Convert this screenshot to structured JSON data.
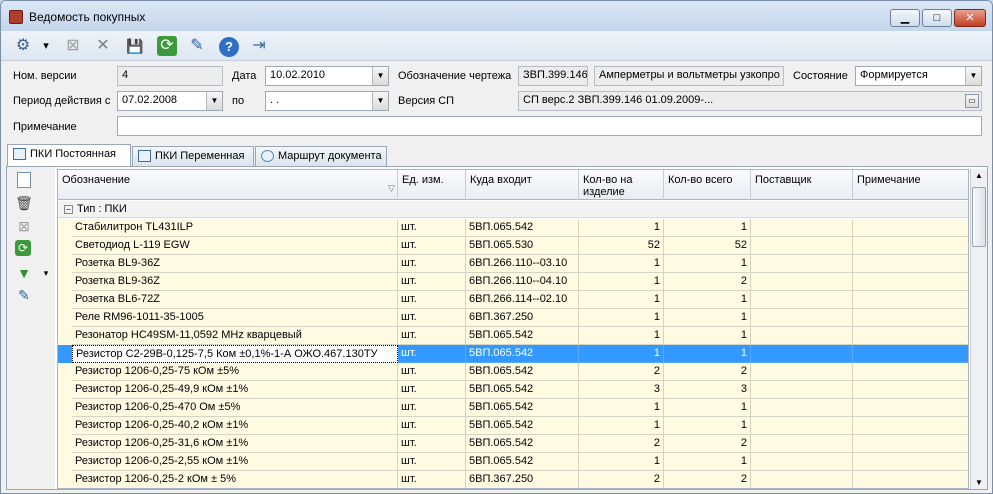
{
  "window": {
    "title": "Ведомость покупных",
    "min": "▁",
    "max": "□",
    "close": "✕"
  },
  "toolbar": {
    "buttons": [
      {
        "name": "tools-icon",
        "glyph": "⚙"
      },
      {
        "name": "dropdown-arrow-icon",
        "glyph": "▾"
      },
      {
        "name": "disabled-box-icon",
        "glyph": "⊠"
      },
      {
        "name": "close-x-icon",
        "glyph": "✕"
      },
      {
        "name": "save-icon",
        "glyph": "💾"
      },
      {
        "name": "refresh-icon",
        "glyph": "⟳"
      },
      {
        "name": "edit-icon",
        "glyph": "✎"
      },
      {
        "name": "help-icon",
        "glyph": "?"
      },
      {
        "name": "exit-icon",
        "glyph": "⇥"
      }
    ]
  },
  "form": {
    "version_label": "Ном. версии",
    "version_value": "4",
    "date_label": "Дата",
    "date_value": "10.02.2010",
    "drawing_label": "Обозначение чертежа",
    "drawing_code": "ЗВП.399.146",
    "drawing_name": "Амперметры и вольтметры узкопро",
    "state_label": "Состояние",
    "state_value": "Формируется",
    "period_label": "Период действия с",
    "period_from": "07.02.2008",
    "period_to_label": "по",
    "period_to": " . .",
    "sp_label": "Версия СП",
    "sp_value": "СП верс.2 ЗВП.399.146 01.09.2009-...",
    "note_label": "Примечание",
    "note_value": ""
  },
  "tabs": [
    "ПКИ Постоянная",
    "ПКИ Переменная",
    "Маршрут документа"
  ],
  "grid": {
    "columns": [
      "Обозначение",
      "Ед. изм.",
      "Куда входит",
      "Кол-во на изделие",
      "Кол-во всего",
      "Поставщик",
      "Примечание"
    ],
    "group": "Тип : ПКИ",
    "rows": [
      [
        "Стабилитрон TL431ILP",
        "шт.",
        "5ВП.065.542",
        "1",
        "1",
        "",
        ""
      ],
      [
        "Светодиод L-119 EGW",
        "шт.",
        "5ВП.065.530",
        "52",
        "52",
        "",
        ""
      ],
      [
        "Розетка BL9-36Z",
        "шт.",
        "6ВП.266.110--03.10",
        "1",
        "1",
        "",
        ""
      ],
      [
        "Розетка BL9-36Z",
        "шт.",
        "6ВП.266.110--04.10",
        "1",
        "2",
        "",
        ""
      ],
      [
        "Розетка BL6-72Z",
        "шт.",
        "6ВП.266.114--02.10",
        "1",
        "1",
        "",
        ""
      ],
      [
        "Реле RM96-1011-35-1005",
        "шт.",
        "6ВП.367.250",
        "1",
        "1",
        "",
        ""
      ],
      [
        "Резонатор HC49SM-11,0592 MHz кварцевый",
        "шт.",
        "5ВП.065.542",
        "1",
        "1",
        "",
        ""
      ],
      [
        "Резистор С2-29В-0,125-7,5 Ком ±0,1%-1-А   ОЖО.467.130ТУ",
        "шт.",
        "5ВП.065.542",
        "1",
        "1",
        "",
        ""
      ],
      [
        "Резистор 1206-0,25-75 кОм ±5%",
        "шт.",
        "5ВП.065.542",
        "2",
        "2",
        "",
        ""
      ],
      [
        "Резистор 1206-0,25-49,9 кОм ±1%",
        "шт.",
        "5ВП.065.542",
        "3",
        "3",
        "",
        ""
      ],
      [
        "Резистор 1206-0,25-470 Ом ±5%",
        "шт.",
        "5ВП.065.542",
        "1",
        "1",
        "",
        ""
      ],
      [
        "Резистор 1206-0,25-40,2 кОм ±1%",
        "шт.",
        "5ВП.065.542",
        "1",
        "1",
        "",
        ""
      ],
      [
        "Резистор 1206-0,25-31,6 кОм ±1%",
        "шт.",
        "5ВП.065.542",
        "2",
        "2",
        "",
        ""
      ],
      [
        "Резистор 1206-0,25-2,55 кОм ±1%",
        "шт.",
        "5ВП.065.542",
        "1",
        "1",
        "",
        ""
      ],
      [
        "Резистор 1206-0,25-2 кОм ± 5%",
        "шт.",
        "6ВП.367.250",
        "2",
        "2",
        "",
        ""
      ]
    ],
    "selected_row": 7
  },
  "side_tools": [
    "new-doc-icon",
    "delete-icon",
    "cancel-icon",
    "refresh-icon",
    "filter-icon",
    "edit-icon"
  ]
}
